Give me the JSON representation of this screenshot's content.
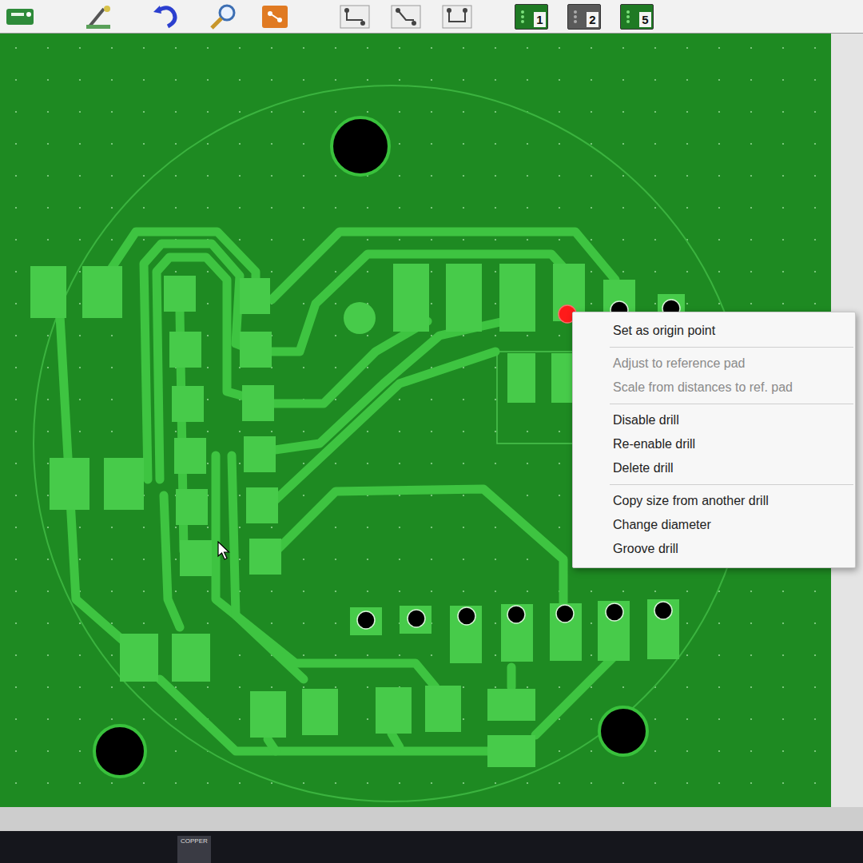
{
  "toolbar": {
    "layers": [
      {
        "label": "1",
        "active": true
      },
      {
        "label": "2",
        "active": false
      },
      {
        "label": "5",
        "active": true
      }
    ]
  },
  "board": {
    "drills": [
      {
        "selected": true
      },
      {
        "selected": false
      },
      {
        "selected": false
      },
      {
        "selected": false
      },
      {
        "selected": false
      },
      {
        "selected": false
      },
      {
        "selected": false
      },
      {
        "selected": false
      },
      {
        "selected": false
      },
      {
        "selected": false
      }
    ]
  },
  "context_menu": {
    "items": [
      {
        "kind": "item",
        "label": "Set as origin point",
        "disabled": false
      },
      {
        "kind": "separator"
      },
      {
        "kind": "item",
        "label": "Adjust to reference pad",
        "disabled": true
      },
      {
        "kind": "item",
        "label": "Scale from distances to ref. pad",
        "disabled": true
      },
      {
        "kind": "separator"
      },
      {
        "kind": "item",
        "label": "Disable drill",
        "disabled": false
      },
      {
        "kind": "item",
        "label": "Re-enable drill",
        "disabled": false
      },
      {
        "kind": "item",
        "label": "Delete drill",
        "disabled": false
      },
      {
        "kind": "separator"
      },
      {
        "kind": "item",
        "label": "Copy size from another drill",
        "disabled": false
      },
      {
        "kind": "item",
        "label": "Change diameter",
        "disabled": false
      },
      {
        "kind": "item",
        "label": "Groove drill",
        "disabled": false
      }
    ]
  },
  "taskbar": {
    "apps": [
      {
        "label": "COPPER"
      }
    ]
  }
}
